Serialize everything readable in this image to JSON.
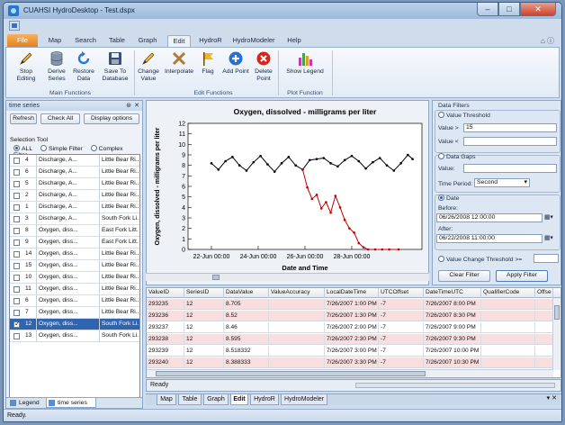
{
  "window": {
    "title": "CUAHSI HydroDesktop - Test.dspx"
  },
  "tabs": {
    "file": "File",
    "items": [
      "Map",
      "Search",
      "Table",
      "Graph",
      "Edit",
      "HydroR",
      "HydroModeler",
      "Help"
    ],
    "active": "Edit"
  },
  "ribbon": {
    "stop_editing": [
      "Stop Editing",
      ""
    ],
    "derive_series": [
      "Derive",
      "Series"
    ],
    "restore_data": [
      "Restore",
      "Data"
    ],
    "save_to_database": [
      "Save To",
      "Database"
    ],
    "main_group": "Main Functions",
    "change_value": [
      "Change",
      "Value"
    ],
    "interpolate": [
      "Interpolate",
      ""
    ],
    "flag": [
      "Flag",
      ""
    ],
    "add_point": [
      "Add Point",
      ""
    ],
    "delete_point": [
      "Delete",
      "Point"
    ],
    "edit_group": "Edit Functions",
    "show_legend": [
      "Show Legend",
      ""
    ],
    "plot_group": "Plot Function"
  },
  "left_panel": {
    "title": "time series",
    "refresh": "Refresh",
    "check_all": "Check All",
    "display_options": "Display options",
    "selection_tool": "Selection Tool",
    "radio_all": "ALL",
    "radio_simple": "Simple Filter",
    "radio_complex": "Complex Filter",
    "series": [
      {
        "id": "4",
        "name": "Discharge, A...",
        "site": "Little Bear Ri...",
        "checked": false
      },
      {
        "id": "6",
        "name": "Discharge, A...",
        "site": "Little Bear Ri...",
        "checked": false
      },
      {
        "id": "5",
        "name": "Discharge, A...",
        "site": "Little Bear Ri...",
        "checked": false
      },
      {
        "id": "2",
        "name": "Discharge, A...",
        "site": "Little Bear Ri...",
        "checked": false
      },
      {
        "id": "1",
        "name": "Discharge, A...",
        "site": "Little Bear Ri...",
        "checked": false
      },
      {
        "id": "3",
        "name": "Discharge, A...",
        "site": "South Fork Li...",
        "checked": false
      },
      {
        "id": "8",
        "name": "Oxygen, diss...",
        "site": "East Fork Litt...",
        "checked": false
      },
      {
        "id": "9",
        "name": "Oxygen, diss...",
        "site": "East Fork Litt...",
        "checked": false
      },
      {
        "id": "14",
        "name": "Oxygen, diss...",
        "site": "Little Bear Ri...",
        "checked": false
      },
      {
        "id": "15",
        "name": "Oxygen, diss...",
        "site": "Little Bear Ri...",
        "checked": false
      },
      {
        "id": "10",
        "name": "Oxygen, diss...",
        "site": "Little Bear Ri...",
        "checked": false
      },
      {
        "id": "11",
        "name": "Oxygen, diss...",
        "site": "Little Bear Ri...",
        "checked": false
      },
      {
        "id": "6",
        "name": "Oxygen, diss...",
        "site": "Little Bear Ri...",
        "checked": false
      },
      {
        "id": "7",
        "name": "Oxygen, diss...",
        "site": "Little Bear Ri...",
        "checked": false
      },
      {
        "id": "12",
        "name": "Oxygen, diss...",
        "site": "South Fork Li...",
        "checked": true
      },
      {
        "id": "13",
        "name": "Oxygen, diss...",
        "site": "South Fork Li...",
        "checked": false
      }
    ],
    "bottom_tabs": [
      "Legend",
      "time series"
    ]
  },
  "chart_data": {
    "type": "line",
    "title": "Oxygen, dissolved - milligrams per liter",
    "xlabel": "Date and Time",
    "ylabel": "Oxygen, dissolved - milligrams per liter",
    "ylim": [
      0,
      12
    ],
    "yticks": [
      "0",
      "1",
      "2",
      "3",
      "4",
      "5",
      "6",
      "7",
      "8",
      "9",
      "10",
      "11",
      "12"
    ],
    "xticks": [
      "22-Jun 00:00",
      "24-Jun 00:00",
      "26-Jun 00:00",
      "28-Jun 00:00"
    ],
    "grid": false,
    "series": [
      {
        "color": "#000000",
        "x": [
          0,
          0.3,
          0.6,
          0.9,
          1.2,
          1.5,
          1.8,
          2.1,
          2.4,
          2.7,
          3.0,
          3.3,
          3.6,
          3.9,
          4.2,
          4.5,
          4.8,
          5.1,
          5.4,
          5.7,
          6.0,
          6.3,
          6.6,
          6.9,
          7.2,
          7.5,
          7.8,
          8.1,
          8.4,
          8.6
        ],
        "y": [
          8.2,
          7.6,
          8.4,
          8.8,
          8.0,
          7.5,
          8.3,
          8.9,
          8.1,
          7.4,
          8.2,
          8.8,
          8.0,
          7.6,
          8.5,
          8.6,
          8.7,
          8.2,
          7.9,
          8.5,
          8.9,
          8.4,
          7.7,
          8.3,
          8.7,
          8.0,
          7.5,
          8.2,
          9.0,
          8.6
        ]
      },
      {
        "color": "#c00000",
        "x": [
          3.9,
          4.1,
          4.3,
          4.5,
          4.7,
          4.9,
          5.1,
          5.3,
          5.5,
          5.7,
          5.9,
          6.1,
          6.3,
          6.5,
          6.7,
          7.0,
          7.3,
          7.6,
          8.0
        ],
        "y": [
          7.6,
          5.9,
          4.8,
          5.2,
          3.9,
          4.5,
          3.5,
          5.1,
          4.0,
          2.8,
          2.0,
          1.6,
          0.6,
          0.2,
          0,
          0,
          0,
          0,
          0
        ]
      }
    ]
  },
  "filters": {
    "data_filters": "Data Filters",
    "value_threshold": "Value Threshold",
    "value_gt_label": "Value >",
    "value_gt": "15",
    "value_lt_label": "Value <",
    "value_lt": "",
    "data_gaps": "Data Gaps",
    "gap_value_label": "Value:",
    "time_period_label": "Time Period:",
    "time_period": "Second",
    "date": "Date",
    "before_label": "Before:",
    "before": "06/26/2008 12:00:00",
    "after_label": "After:",
    "after": "06/22/2008 11:00:00",
    "value_change": "Value Change Threshold >=",
    "clear": "Clear Filter",
    "apply": "Apply Filter"
  },
  "table": {
    "headers": [
      "ValueID",
      "SeriesID",
      "DataValue",
      "ValueAccuracy",
      "LocalDateTime",
      "UTCOffset",
      "DateTimeUTC",
      "QualifierCode",
      "Offse"
    ],
    "rows": [
      [
        "293235",
        "12",
        "8.705",
        "",
        "7/26/2007 1:00 PM",
        "-7",
        "7/26/2007 8:00 PM",
        "",
        "",
        true
      ],
      [
        "293236",
        "12",
        "8.52",
        "",
        "7/26/2007 1:30 PM",
        "-7",
        "7/26/2007 8:30 PM",
        "",
        "",
        true
      ],
      [
        "293237",
        "12",
        "8.46",
        "",
        "7/26/2007 2:00 PM",
        "-7",
        "7/26/2007 9:00 PM",
        "",
        "",
        false
      ],
      [
        "293238",
        "12",
        "8.595",
        "",
        "7/26/2007 2:30 PM",
        "-7",
        "7/26/2007 9:30 PM",
        "",
        "",
        true
      ],
      [
        "293239",
        "12",
        "8.518332",
        "",
        "7/26/2007 3:00 PM",
        "-7",
        "7/26/2007 10:00 PM",
        "",
        "",
        false
      ],
      [
        "293240",
        "12",
        "8.388333",
        "",
        "7/26/2007 3:30 PM",
        "-7",
        "7/26/2007 10:30 PM",
        "",
        "",
        true
      ]
    ]
  },
  "ready_text": "Ready",
  "doc_tabs": [
    "Map",
    "Table",
    "Graph",
    "Edit",
    "HydroR",
    "HydroModeler"
  ],
  "doc_tab_active": "Edit",
  "doc_tab_controls": "▾ ✕",
  "status": "Ready."
}
